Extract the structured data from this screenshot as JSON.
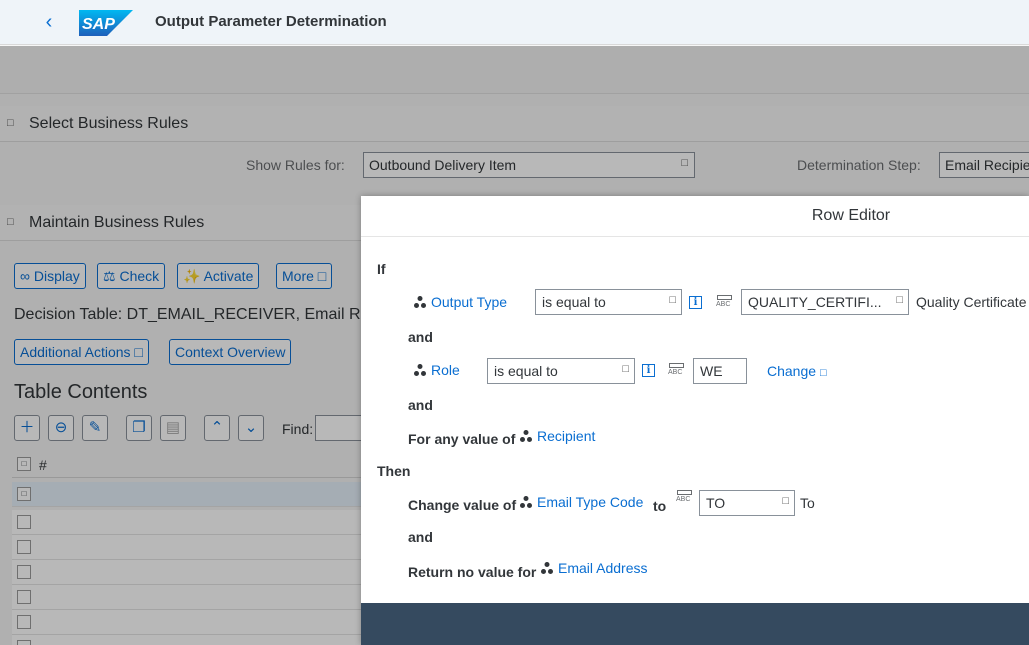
{
  "shell": {
    "title": "Output Parameter Determination",
    "logo": "SAP"
  },
  "sections": {
    "select": "Select Business Rules",
    "maintain": "Maintain Business Rules"
  },
  "filters": {
    "show_rules_label": "Show Rules for:",
    "show_rules_value": "Outbound Delivery Item",
    "determination_step_label": "Determination Step:",
    "determination_step_value": "Email Recipie"
  },
  "toolbar": {
    "display": "Display",
    "check": "Check",
    "activate": "Activate",
    "more": "More"
  },
  "decision_table": "Decision Table: DT_EMAIL_RECEIVER, Email R",
  "actions": {
    "additional": "Additional Actions",
    "context": "Context Overview"
  },
  "table": {
    "title": "Table Contents",
    "find_label": "Find:",
    "col_number": "#"
  },
  "dialog": {
    "title": "Row Editor",
    "if": "If",
    "and": "and",
    "then": "Then",
    "cond1": {
      "attr": "Output Type",
      "op": "is equal to",
      "value": "QUALITY_CERTIFI...",
      "desc": "Quality Certificate"
    },
    "cond2": {
      "attr": "Role",
      "op": "is equal to",
      "value": "WE",
      "change": "Change"
    },
    "any_value_prefix": "For any value of",
    "any_value_attr": "Recipient",
    "change_prefix": "Change value of",
    "change_attr": "Email Type Code",
    "to_word": "to",
    "change_value": "TO",
    "change_desc": "To",
    "return_prefix": "Return no value for",
    "return_attr": "Email Address"
  }
}
